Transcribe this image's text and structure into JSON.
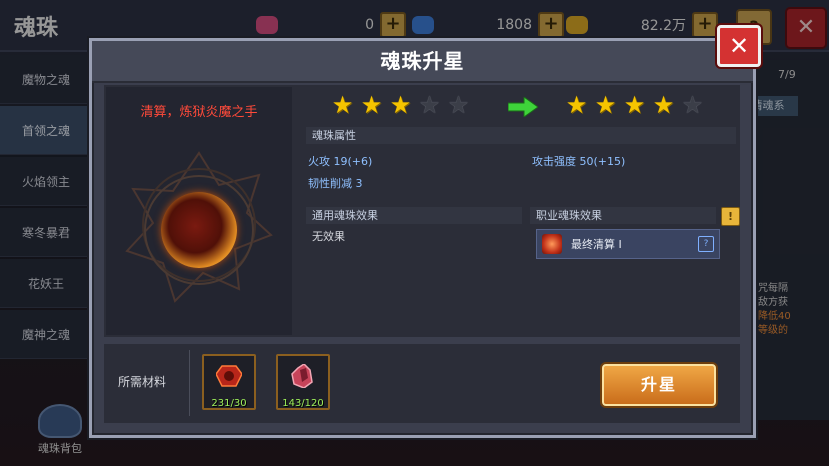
{
  "background": {
    "title": "魂珠",
    "resources": [
      {
        "name": "pink-gem",
        "value": "0",
        "color": "#d24c7e"
      },
      {
        "name": "blue-gem",
        "value": "1808",
        "color": "#3c7bd6"
      },
      {
        "name": "gold-coin",
        "value": "82.2万",
        "color": "#d7a726"
      }
    ],
    "side_items": [
      "魔物之魂",
      "首领之魂",
      "火焰领主",
      "寒冬暴君",
      "花妖王",
      "魔神之魂"
    ],
    "right_fraction": "7/9",
    "right_tab": "请魂系",
    "right_text_line1": "，符咒每隔",
    "right_text_line2": "中的敌方获",
    "right_text_line3": "火抗降低40",
    "right_text_line4": "更高等级的",
    "bag_label": "魂珠背包"
  },
  "modal": {
    "title": "魂珠升星",
    "close_label": "✕",
    "soul_name": "清算，炼狱炎魔之手",
    "current_stars": 3,
    "next_stars": 4,
    "max_stars": 5,
    "section_attr": "魂珠属性",
    "attr1": "火攻 19(+6)",
    "attr2": "攻击强度 50(+15)",
    "attr3": "韧性削减 3",
    "section_common": "通用魂珠效果",
    "common_effect": "无效果",
    "section_job": "职业魂珠效果",
    "job_effect": "最终清算 Ⅰ",
    "materials_label": "所需材料",
    "materials": [
      {
        "name": "red-soul-gem",
        "count": "231/30",
        "color": "#b8261a"
      },
      {
        "name": "crimson-crystal",
        "count": "143/120",
        "color": "#c7445a"
      }
    ],
    "upgrade_label": "升星"
  }
}
